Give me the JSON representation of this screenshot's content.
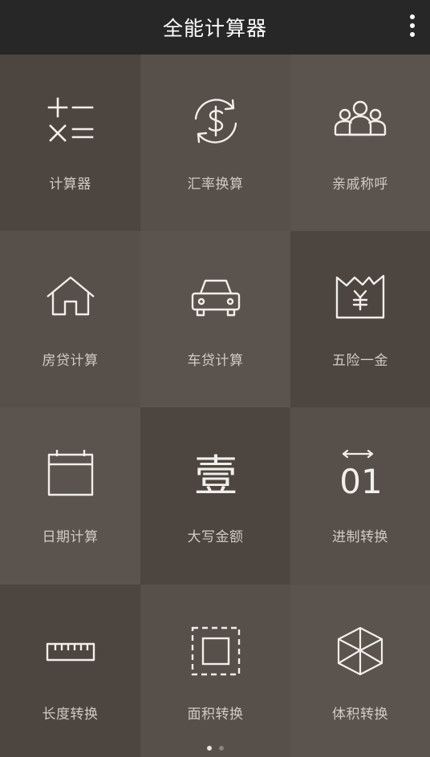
{
  "app": {
    "title": "全能计算器",
    "menu_icon": "more-vert-icon"
  },
  "tiles": [
    {
      "label": "计算器",
      "icon": "calculator-icon"
    },
    {
      "label": "汇率换算",
      "icon": "currency-exchange-icon"
    },
    {
      "label": "亲戚称呼",
      "icon": "family-icon"
    },
    {
      "label": "房贷计算",
      "icon": "house-icon"
    },
    {
      "label": "车贷计算",
      "icon": "car-icon"
    },
    {
      "label": "五险一金",
      "icon": "yuan-envelope-icon"
    },
    {
      "label": "日期计算",
      "icon": "calendar-icon"
    },
    {
      "label": "大写金额",
      "icon": "chinese-numeral-icon"
    },
    {
      "label": "进制转换",
      "icon": "binary-icon"
    },
    {
      "label": "长度转换",
      "icon": "ruler-icon"
    },
    {
      "label": "面积转换",
      "icon": "area-icon"
    },
    {
      "label": "体积转换",
      "icon": "cube-icon"
    }
  ],
  "icon_glyphs": {
    "uppercase_one": "壹",
    "binary_digits": "01"
  },
  "pager": {
    "pages": 2,
    "current_page": 1
  },
  "colors": {
    "app_bar": "#272727",
    "tile_dark": "#4c4540",
    "tile_mid": "#564f4a",
    "tile_light": "#5b534d",
    "label": "#d2cbc4",
    "icon_stroke": "#f2eeea"
  }
}
